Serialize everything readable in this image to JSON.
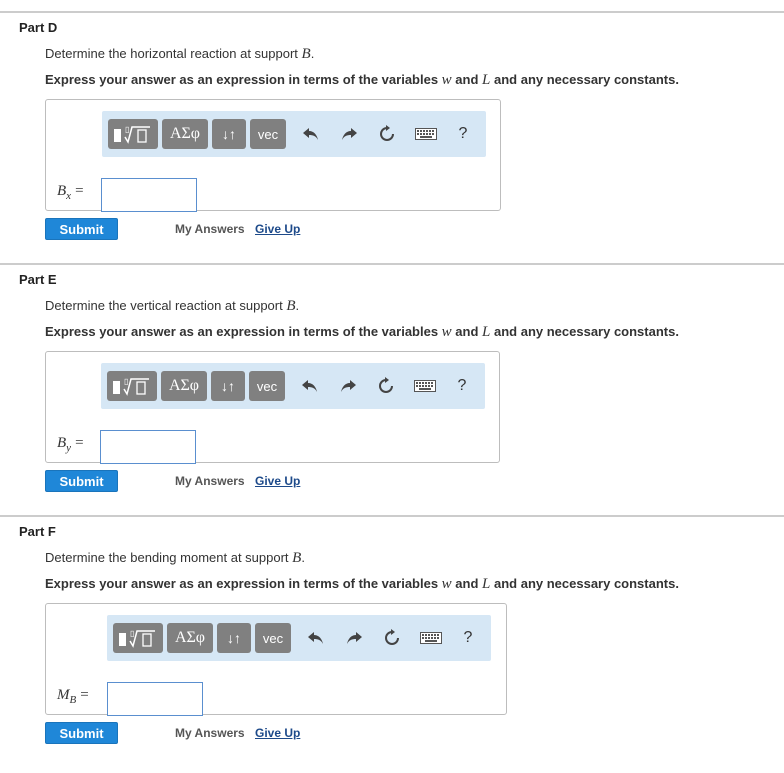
{
  "parts": [
    {
      "title": "Part D",
      "prompt_text": "Determine the horizontal reaction at support ",
      "prompt_var": "B",
      "instr_a": "Express your answer as an expression in terms of the variables ",
      "instr_var1": "w",
      "instr_and": " and ",
      "instr_var2": "L",
      "instr_b": " and any necessary constants.",
      "var_main": "B",
      "var_sub": "x",
      "eq": "=",
      "answer_value": ""
    },
    {
      "title": "Part E",
      "prompt_text": "Determine the vertical reaction at support ",
      "prompt_var": "B",
      "instr_a": "Express your answer as an expression in terms of the variables ",
      "instr_var1": "w",
      "instr_and": " and ",
      "instr_var2": "L",
      "instr_b": " and any necessary constants.",
      "var_main": "B",
      "var_sub": "y",
      "eq": "=",
      "answer_value": ""
    },
    {
      "title": "Part F",
      "prompt_text": "Determine the bending moment at support ",
      "prompt_var": "B",
      "instr_a": "Express your answer as an expression in terms of the variables ",
      "instr_var1": "w",
      "instr_and": " and ",
      "instr_var2": "L",
      "instr_b": " and any necessary constants.",
      "var_main": "M",
      "var_sub": "B",
      "eq": "=",
      "answer_value": ""
    }
  ],
  "toolbar": {
    "greek_label": "ΑΣφ",
    "subscript_label": "↓↑",
    "vec_label": "vec",
    "help_label": "?",
    "icons": [
      "fraction-sqrt-icon",
      "undo-icon",
      "redo-icon",
      "reset-icon",
      "keyboard-icon",
      "help-icon"
    ]
  },
  "actions": {
    "submit_label": "Submit",
    "my_answers_label": "My Answers",
    "give_up_label": "Give Up"
  },
  "colors": {
    "toolbar_bg": "#d6e7f5",
    "toolbar_button": "#808080",
    "submit_button": "#1f87d8",
    "input_border": "#5a8fcf",
    "link": "#1d4a8a"
  }
}
